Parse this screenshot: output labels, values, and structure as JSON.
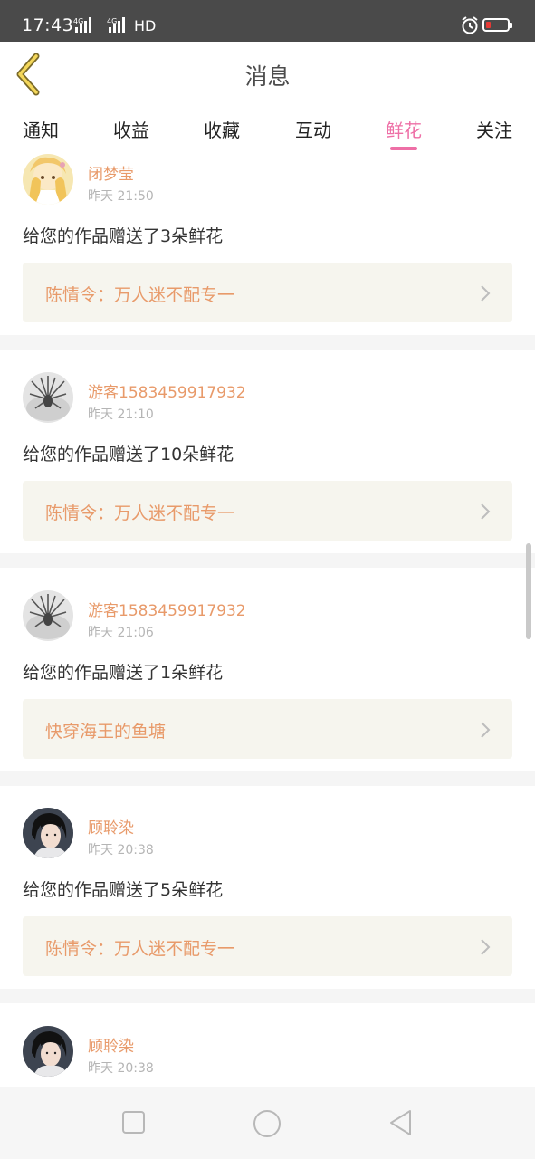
{
  "status_bar": {
    "time": "17:43",
    "signal1": "4G",
    "signal2": "4G",
    "hd": "HD"
  },
  "header": {
    "title": "消息",
    "back_icon": "chevron-left-icon"
  },
  "tabs": [
    {
      "label": "通知"
    },
    {
      "label": "收益"
    },
    {
      "label": "收藏"
    },
    {
      "label": "互动"
    },
    {
      "label": "鲜花",
      "active": true
    },
    {
      "label": "关注"
    }
  ],
  "accent_color": "#ee6fa6",
  "name_color": "#e89a6a",
  "messages": [
    {
      "user": "闭梦莹",
      "time": "昨天 21:50",
      "text": "给您的作品赠送了3朵鲜花",
      "work": "陈情令：万人迷不配专一",
      "avatar": "anime-girl"
    },
    {
      "user": "游客1583459917932",
      "time": "昨天 21:10",
      "text": "给您的作品赠送了10朵鲜花",
      "work": "陈情令：万人迷不配专一",
      "avatar": "sketch"
    },
    {
      "user": "游客1583459917932",
      "time": "昨天 21:06",
      "text": "给您的作品赠送了1朵鲜花",
      "work": "快穿海王的鱼塘",
      "avatar": "sketch"
    },
    {
      "user": "顾聆染",
      "time": "昨天 20:38",
      "text": "给您的作品赠送了5朵鲜花",
      "work": "陈情令：万人迷不配专一",
      "avatar": "portrait"
    },
    {
      "user": "顾聆染",
      "time": "昨天 20:38",
      "text": "",
      "work": "",
      "avatar": "portrait"
    }
  ]
}
